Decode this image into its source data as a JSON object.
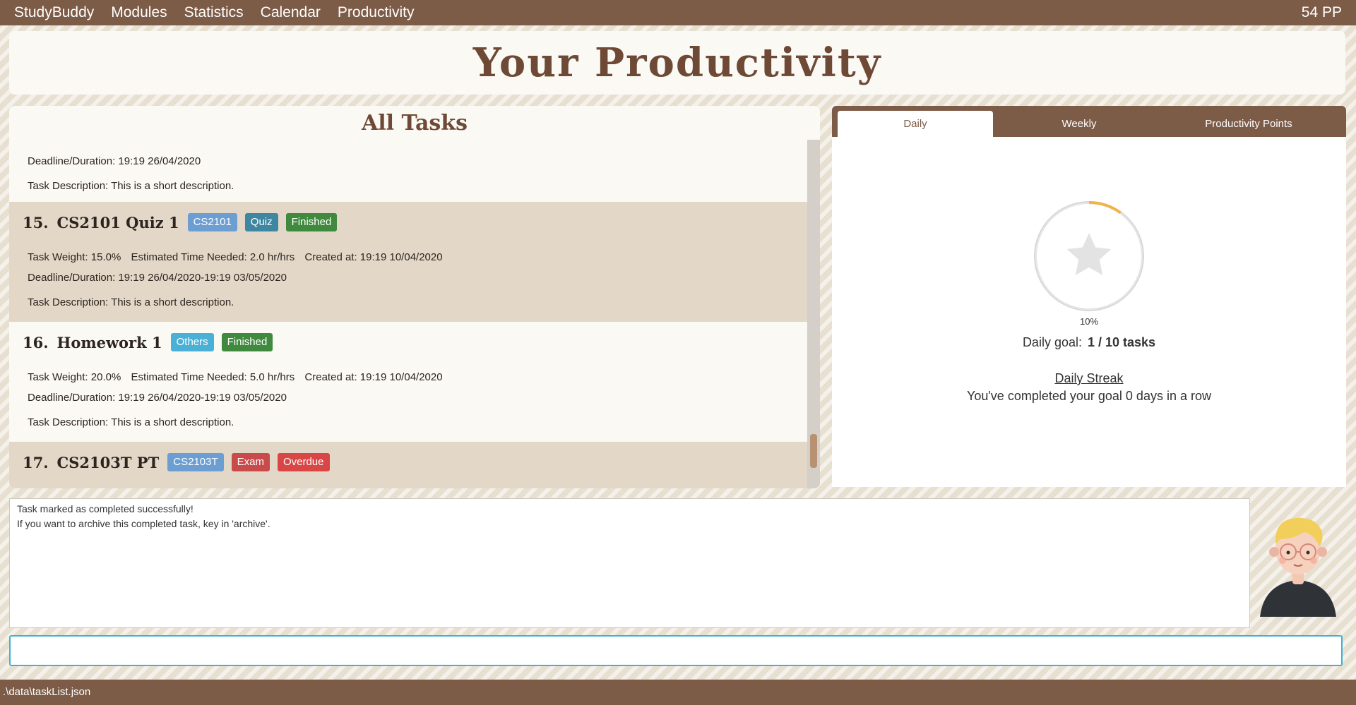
{
  "menubar": {
    "items": [
      "StudyBuddy",
      "Modules",
      "Statistics",
      "Calendar",
      "Productivity"
    ],
    "points": "54 PP"
  },
  "page_title": "Your Productivity",
  "tasks": {
    "heading": "All Tasks",
    "partial_top": {
      "deadline": "Deadline/Duration: 19:19 26/04/2020",
      "description": "Task Description: This is a short description."
    },
    "items": [
      {
        "number": "15.",
        "name": "CS2101 Quiz 1",
        "tags": [
          "CS2101",
          "Quiz",
          "Finished"
        ],
        "weight": "Task Weight: 15.0%",
        "time_needed": "Estimated Time Needed: 2.0 hr/hrs",
        "created": "Created at: 19:19 10/04/2020",
        "deadline": "Deadline/Duration: 19:19 26/04/2020-19:19 03/05/2020",
        "description": "Task Description: This is a short description."
      },
      {
        "number": "16.",
        "name": "Homework 1",
        "tags": [
          "Others",
          "Finished"
        ],
        "weight": "Task Weight: 20.0%",
        "time_needed": "Estimated Time Needed: 5.0 hr/hrs",
        "created": "Created at: 19:19 10/04/2020",
        "deadline": "Deadline/Duration: 19:19 26/04/2020-19:19 03/05/2020",
        "description": "Task Description: This is a short description."
      },
      {
        "number": "17.",
        "name": "CS2103T PT",
        "tags": [
          "CS2103T",
          "Exam",
          "Overdue"
        ]
      }
    ]
  },
  "stats": {
    "tabs": [
      "Daily",
      "Weekly",
      "Productivity Points"
    ],
    "active_tab": "Daily",
    "progress_fraction": 0.1,
    "progress_label": "10%",
    "goal_label": "Daily goal:",
    "goal_value": "1 / 10 tasks",
    "streak_title": "Daily Streak",
    "streak_text": "You've completed your goal 0 days in a row",
    "icon": "star-icon",
    "ring_color": "#f0b34a"
  },
  "result": {
    "lines": [
      "Task marked as completed successfully!",
      "If you want to archive this completed task, key in 'archive'."
    ]
  },
  "command": {
    "value": ""
  },
  "status": {
    "path": ".\\data\\taskList.json"
  },
  "colors": {
    "brand": "#7c5b47",
    "finished": "#3f8a3e",
    "overdue": "#d94646",
    "input_border": "#3fb2d3"
  }
}
